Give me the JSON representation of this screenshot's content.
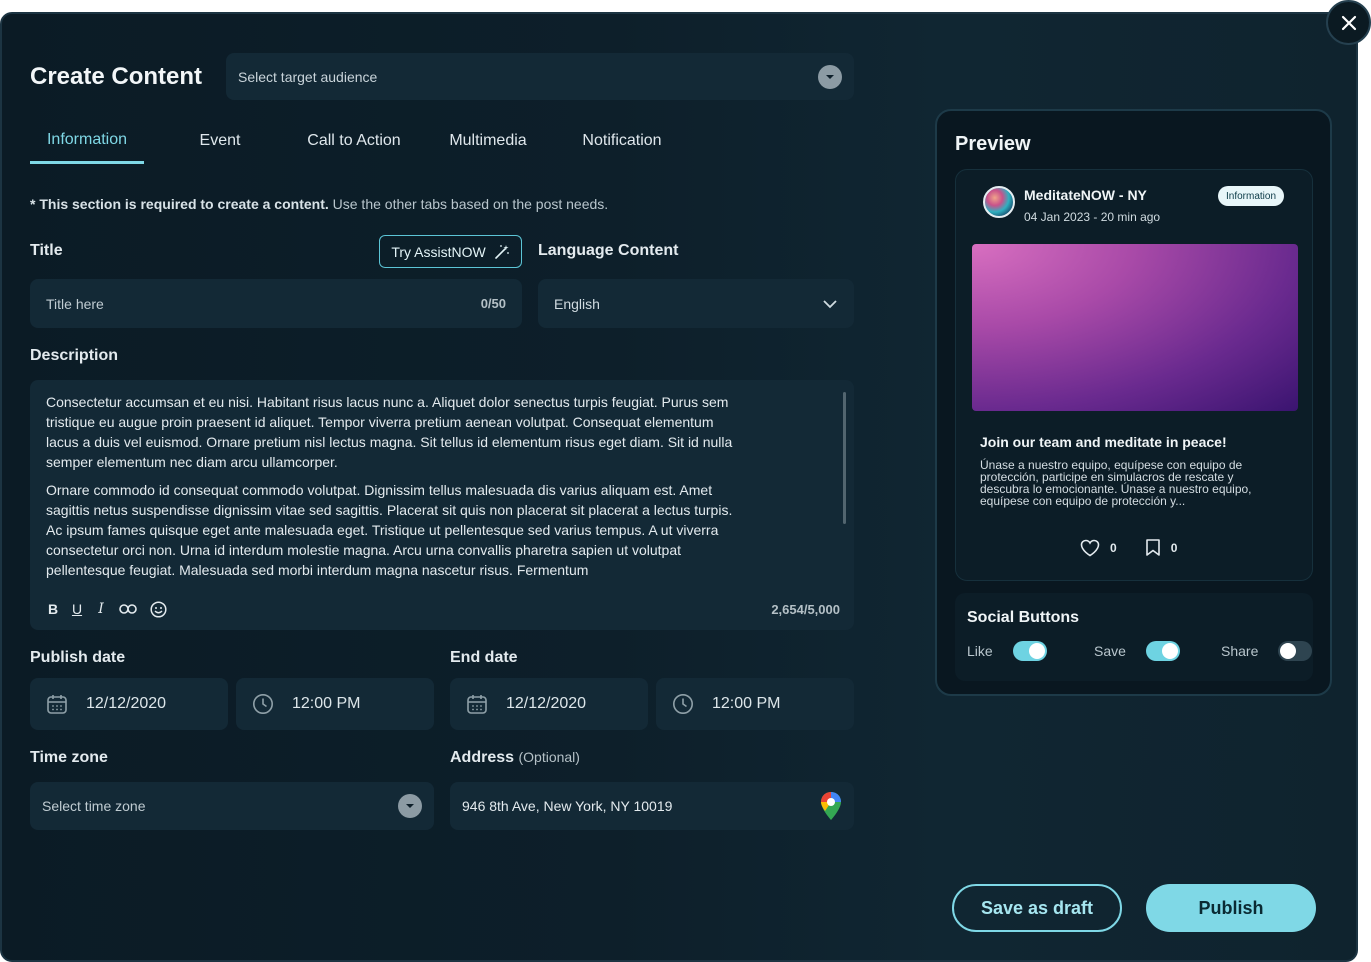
{
  "header": {
    "title": "Create Content",
    "audience_placeholder": "Select target audience"
  },
  "tabs": [
    {
      "label": "Information",
      "active": true
    },
    {
      "label": "Event",
      "active": false
    },
    {
      "label": "Call to Action",
      "active": false
    },
    {
      "label": "Multimedia",
      "active": false
    },
    {
      "label": "Notification",
      "active": false
    }
  ],
  "notice": {
    "bold": "* This section is required to create a content.",
    "text": " Use the other tabs based on the post needs."
  },
  "title_field": {
    "label": "Title",
    "assist_label": "Try AssistNOW",
    "placeholder": "Title here",
    "counter": "0/50"
  },
  "language": {
    "label": "Language Content",
    "value": "English"
  },
  "description": {
    "label": "Description",
    "paragraphs": [
      "Consectetur accumsan et eu nisi. Habitant risus lacus nunc a. Aliquet dolor senectus turpis feugiat. Purus sem tristique eu augue proin praesent id aliquet. Tempor viverra pretium aenean volutpat. Consequat elementum lacus a duis vel euismod. Ornare pretium nisl lectus magna. Sit tellus id elementum risus eget diam. Sit id nulla semper elementum nec diam arcu ullamcorper.",
      "Ornare commodo id consequat commodo volutpat. Dignissim tellus malesuada dis varius aliquam est. Amet sagittis netus suspendisse dignissim vitae sed sagittis. Placerat sit quis non placerat sit placerat a lectus turpis. Ac ipsum fames quisque eget ante malesuada eget. Tristique ut pellentesque sed varius tempus. A ut viverra consectetur orci non. Urna id interdum molestie magna. Arcu urna convallis pharetra sapien ut volutpat pellentesque feugiat. Malesuada sed morbi interdum magna nascetur risus. Fermentum"
    ],
    "char_count": "2,654/5,000",
    "toolbar": [
      "bold-icon",
      "underline-icon",
      "italic-icon",
      "link-icon",
      "emoji-icon"
    ]
  },
  "publish": {
    "label": "Publish date",
    "date": "12/12/2020",
    "time": "12:00 PM"
  },
  "end": {
    "label": "End date",
    "date": "12/12/2020",
    "time": "12:00 PM"
  },
  "timezone": {
    "label": "Time zone",
    "placeholder": "Select time zone"
  },
  "address": {
    "label": "Address",
    "optional": "(Optional)",
    "value": "946 8th Ave, New York, NY 10019"
  },
  "preview": {
    "title": "Preview",
    "card": {
      "name": "MeditateNOW - NY",
      "date": "04 Jan 2023 - 20 min ago",
      "badge": "Information",
      "headline": "Join our team and meditate in peace!",
      "body": "Únase a nuestro equipo, equípese con equipo de protección, participe en simulacros de rescate y descubra lo emocionante. Únase a nuestro equipo, equípese con equipo de protección y...",
      "likes": "0",
      "saves": "0"
    },
    "social": {
      "title": "Social Buttons",
      "like_label": "Like",
      "like_on": true,
      "save_label": "Save",
      "save_on": true,
      "share_label": "Share",
      "share_on": false
    }
  },
  "actions": {
    "draft_label": "Save as draft",
    "publish_label": "Publish"
  },
  "colors": {
    "accent": "#7fd8e6",
    "background": "#0d1f2a",
    "field": "#132936"
  }
}
